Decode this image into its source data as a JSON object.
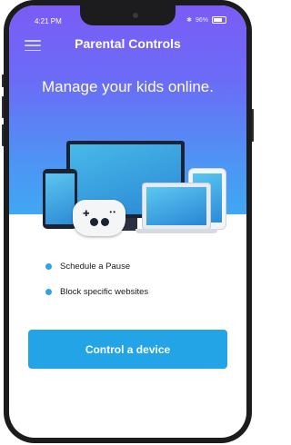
{
  "status_bar": {
    "time": "4:21 PM",
    "battery": "96%"
  },
  "header": {
    "title": "Parental Controls",
    "menu_icon": "hamburger-menu-icon"
  },
  "hero": {
    "headline": "Manage your kids online."
  },
  "features": [
    {
      "label": "Schedule a Pause"
    },
    {
      "label": "Block specific websites"
    }
  ],
  "cta": {
    "label": "Control a device"
  },
  "colors": {
    "gradient_top": "#7a5cf5",
    "gradient_bottom": "#3fa8f2",
    "accent": "#23a4e6",
    "bullet": "#2ea3e6"
  }
}
